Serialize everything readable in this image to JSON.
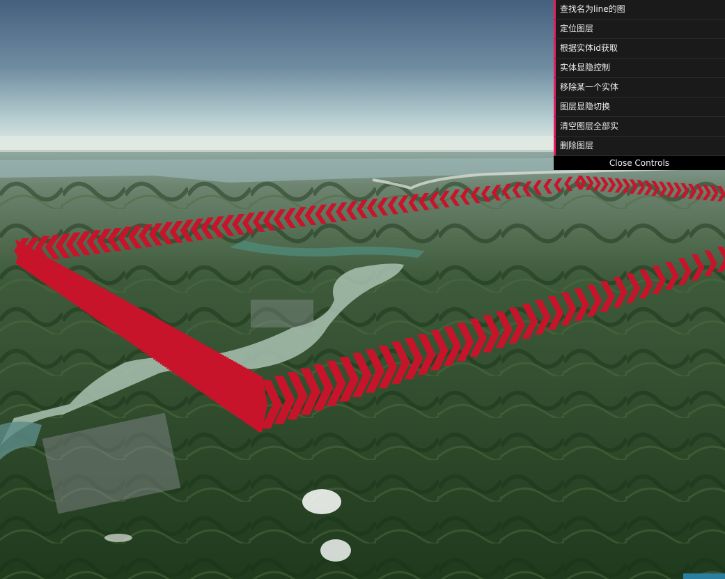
{
  "controls": {
    "items": [
      {
        "label": "查找名为line的图"
      },
      {
        "label": "定位图层"
      },
      {
        "label": "根据实体id获取"
      },
      {
        "label": "实体显隐控制"
      },
      {
        "label": "移除某一个实体"
      },
      {
        "label": "图层显隐切换"
      },
      {
        "label": "清空图层全部实"
      },
      {
        "label": "删除图层"
      }
    ],
    "close_label": "Close Controls"
  },
  "colors": {
    "accent": "#e61d5f",
    "arrow": "#c8142a",
    "arrow_dark": "#7a0a16",
    "panel_bg": "#1a1a1a"
  }
}
